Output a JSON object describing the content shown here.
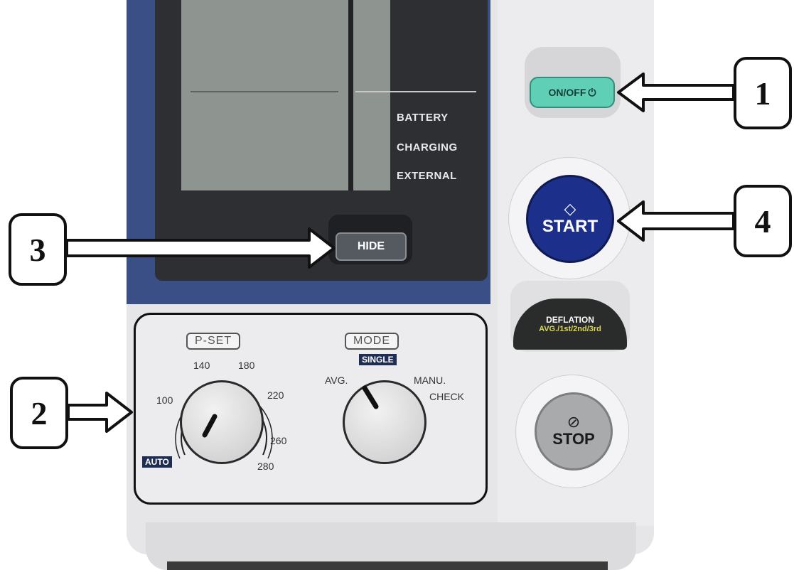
{
  "display": {
    "status_indicators": [
      "BATTERY",
      "CHARGING",
      "EXTERNAL"
    ]
  },
  "buttons": {
    "hide": "HIDE",
    "on_off": "ON/OFF",
    "on_off_icon": "power-icon",
    "start": "START",
    "start_icon": "diamond-arrow-icon",
    "stop": "STOP",
    "stop_icon": "stop-octagon-icon",
    "deflation_title": "DEFLATION",
    "deflation_options": "AVG./1st/2nd/3rd"
  },
  "pset_dial": {
    "label": "P-SET",
    "auto_tag": "AUTO",
    "ticks": [
      "100",
      "140",
      "180",
      "220",
      "260",
      "280"
    ]
  },
  "mode_dial": {
    "label": "MODE",
    "single_tag": "SINGLE",
    "options": [
      "AVG.",
      "MANU.",
      "CHECK"
    ]
  },
  "callouts": [
    "1",
    "2",
    "3",
    "4"
  ],
  "colors": {
    "device_blue": "#3a4f86",
    "lcd": "#8e9591",
    "on_off_green": "#5fcfb5",
    "start_blue": "#1c2f8a",
    "stop_gray": "#a9aaac"
  }
}
